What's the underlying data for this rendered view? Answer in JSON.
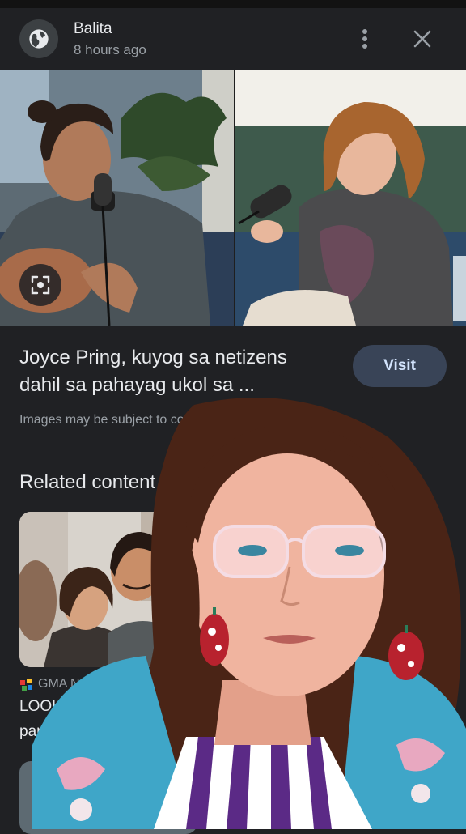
{
  "header": {
    "source_name": "Balita",
    "time_ago": "8 hours ago"
  },
  "article": {
    "title_line1": "Joyce Pring, kuyog sa netizens",
    "title_line2": "dahil sa pahayag ukol sa ...",
    "visit_label": "Visit",
    "copyright_note": "Images may be subject to copyright. L"
  },
  "related": {
    "heading": "Related content",
    "items": [
      {
        "source": "GMA Net",
        "title_line1": "LOOK",
        "title_line2": "par"
      }
    ]
  },
  "icons": {
    "globe": "globe-icon",
    "more": "more-vert-icon",
    "close": "close-icon",
    "lens": "lens-search-icon",
    "gma": "gma-logo-icon"
  },
  "colors": {
    "background": "#202124",
    "visit_button": "#394457",
    "visit_text": "#d2e3fc"
  }
}
